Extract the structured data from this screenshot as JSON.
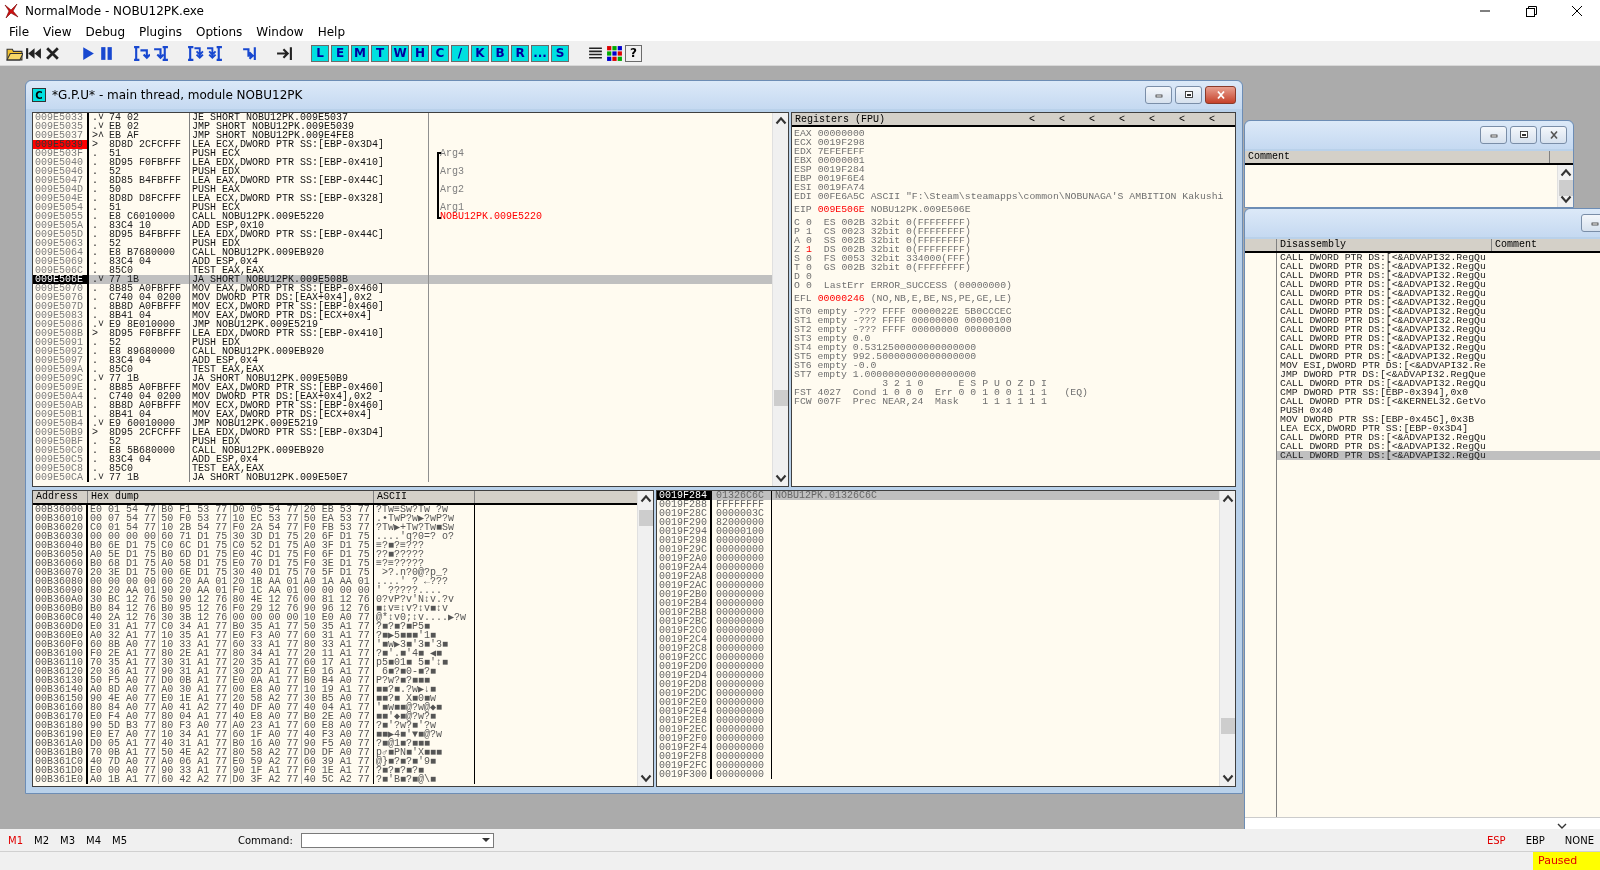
{
  "window": {
    "title": "NormalMode - NOBU12PK.exe"
  },
  "menu": [
    "File",
    "View",
    "Debug",
    "Plugins",
    "Options",
    "Window",
    "Help"
  ],
  "toolbar": {
    "letter_buttons": [
      "L",
      "E",
      "M",
      "T",
      "W",
      "H",
      "C",
      "/",
      "K",
      "B",
      "R",
      "...",
      "S"
    ],
    "help": "?"
  },
  "cpu_window": {
    "icon_letter": "C",
    "title": "*G.P.U* - main thread, module NOBU12PK"
  },
  "disassembly": {
    "rows": [
      {
        "address": "009E5033",
        "marker": ".˅",
        "hex": "74 02",
        "command": "JE SHORT NOBU12PK.009E5037",
        "selected": false,
        "breakpoint": false
      },
      {
        "address": "009E5035",
        "marker": ".˅",
        "hex": "EB 02",
        "command": "JMP SHORT NOBU12PK.009E5039",
        "selected": false,
        "breakpoint": false
      },
      {
        "address": "009E5037",
        "marker": ">˄",
        "hex": "EB AF",
        "command": "JMP SHORT NOBU12PK.009E4FE8",
        "selected": false,
        "breakpoint": false
      },
      {
        "address": "009E5039",
        "marker": ">",
        "hex": "8D8D 2CFCFFF",
        "command": "LEA ECX,DWORD PTR SS:[EBP-0x3D4]",
        "selected": false,
        "breakpoint": true
      },
      {
        "address": "009E503F",
        "marker": ".",
        "hex": "51",
        "command": "PUSH ECX",
        "comment": {
          "text": "Arg4",
          "kind": "arg"
        },
        "selected": false,
        "breakpoint": false
      },
      {
        "address": "009E5040",
        "marker": ".",
        "hex": "8D95 F0FBFFF",
        "command": "LEA EDX,DWORD PTR SS:[EBP-0x410]",
        "selected": false,
        "breakpoint": false
      },
      {
        "address": "009E5046",
        "marker": ".",
        "hex": "52",
        "command": "PUSH EDX",
        "comment": {
          "text": "Arg3",
          "kind": "arg"
        },
        "selected": false,
        "breakpoint": false
      },
      {
        "address": "009E5047",
        "marker": ".",
        "hex": "8D85 B4FBFFF",
        "command": "LEA EAX,DWORD PTR SS:[EBP-0x44C]",
        "selected": false,
        "breakpoint": false
      },
      {
        "address": "009E504D",
        "marker": ".",
        "hex": "50",
        "command": "PUSH EAX",
        "comment": {
          "text": "Arg2",
          "kind": "arg"
        },
        "selected": false,
        "breakpoint": false
      },
      {
        "address": "009E504E",
        "marker": ".",
        "hex": "8D8D D8FCFFF",
        "command": "LEA ECX,DWORD PTR SS:[EBP-0x328]",
        "selected": false,
        "breakpoint": false
      },
      {
        "address": "009E5054",
        "marker": ".",
        "hex": "51",
        "command": "PUSH ECX",
        "comment": {
          "text": "Arg1",
          "kind": "arg"
        },
        "selected": false,
        "breakpoint": false
      },
      {
        "address": "009E5055",
        "marker": ".",
        "hex": "E8 C6010000",
        "command": "CALL NOBU12PK.009E5220",
        "comment": {
          "text": "NOBU12PK.009E5220",
          "kind": "call"
        },
        "selected": false,
        "breakpoint": false
      },
      {
        "address": "009E505A",
        "marker": ".",
        "hex": "83C4 10",
        "command": "ADD ESP,0x10",
        "selected": false,
        "breakpoint": false
      },
      {
        "address": "009E505D",
        "marker": ".",
        "hex": "8D95 B4FBFFF",
        "command": "LEA EDX,DWORD PTR SS:[EBP-0x44C]",
        "selected": false,
        "breakpoint": false
      },
      {
        "address": "009E5063",
        "marker": ".",
        "hex": "52",
        "command": "PUSH EDX",
        "selected": false,
        "breakpoint": false
      },
      {
        "address": "009E5064",
        "marker": ".",
        "hex": "E8 B7680000",
        "command": "CALL NOBU12PK.009EB920",
        "selected": false,
        "breakpoint": false
      },
      {
        "address": "009E5069",
        "marker": ".",
        "hex": "83C4 04",
        "command": "ADD ESP,0x4",
        "selected": false,
        "breakpoint": false
      },
      {
        "address": "009E506C",
        "marker": ".",
        "hex": "85C0",
        "command": "TEST EAX,EAX",
        "selected": false,
        "breakpoint": false
      },
      {
        "address": "009E506E",
        "marker": ".˅",
        "hex": "77 1B",
        "command": "JA SHORT NOBU12PK.009E508B",
        "selected": true,
        "breakpoint": false
      },
      {
        "address": "009E5070",
        "marker": ".",
        "hex": "8B85 A0FBFFF",
        "command": "MOV EAX,DWORD PTR SS:[EBP-0x460]",
        "selected": false,
        "breakpoint": false
      },
      {
        "address": "009E5076",
        "marker": ".",
        "hex": "C740 04 0200",
        "command": "MOV DWORD PTR DS:[EAX+0x4],0x2",
        "selected": false,
        "breakpoint": false
      },
      {
        "address": "009E507D",
        "marker": ".",
        "hex": "8B8D A0FBFFF",
        "command": "MOV ECX,DWORD PTR SS:[EBP-0x460]",
        "selected": false,
        "breakpoint": false
      },
      {
        "address": "009E5083",
        "marker": ".",
        "hex": "8B41 04",
        "command": "MOV EAX,DWORD PTR DS:[ECX+0x4]",
        "selected": false,
        "breakpoint": false
      },
      {
        "address": "009E5086",
        "marker": ".˅",
        "hex": "E9 8E010000",
        "command": "JMP NOBU12PK.009E5219",
        "selected": false,
        "breakpoint": false
      },
      {
        "address": "009E508B",
        "marker": ">",
        "hex": "8D95 F0FBFFF",
        "command": "LEA EDX,DWORD PTR SS:[EBP-0x410]",
        "selected": false,
        "breakpoint": false
      },
      {
        "address": "009E5091",
        "marker": ".",
        "hex": "52",
        "command": "PUSH EDX",
        "selected": false,
        "breakpoint": false
      },
      {
        "address": "009E5092",
        "marker": ".",
        "hex": "E8 89680000",
        "command": "CALL NOBU12PK.009EB920",
        "selected": false,
        "breakpoint": false
      },
      {
        "address": "009E5097",
        "marker": ".",
        "hex": "83C4 04",
        "command": "ADD ESP,0x4",
        "selected": false,
        "breakpoint": false
      },
      {
        "address": "009E509A",
        "marker": ".",
        "hex": "85C0",
        "command": "TEST EAX,EAX",
        "selected": false,
        "breakpoint": false
      },
      {
        "address": "009E509C",
        "marker": ".˅",
        "hex": "77 1B",
        "command": "JA SHORT NOBU12PK.009E50B9",
        "selected": false,
        "breakpoint": false
      },
      {
        "address": "009E509E",
        "marker": ".",
        "hex": "8B85 A0FBFFF",
        "command": "MOV EAX,DWORD PTR SS:[EBP-0x460]",
        "selected": false,
        "breakpoint": false
      },
      {
        "address": "009E50A4",
        "marker": ".",
        "hex": "C740 04 0200",
        "command": "MOV DWORD PTR DS:[EAX+0x4],0x2",
        "selected": false,
        "breakpoint": false
      },
      {
        "address": "009E50AB",
        "marker": ".",
        "hex": "8B8D A0FBFFF",
        "command": "MOV ECX,DWORD PTR SS:[EBP-0x460]",
        "selected": false,
        "breakpoint": false
      },
      {
        "address": "009E50B1",
        "marker": ".",
        "hex": "8B41 04",
        "command": "MOV EAX,DWORD PTR DS:[ECX+0x4]",
        "selected": false,
        "breakpoint": false
      },
      {
        "address": "009E50B4",
        "marker": ".˅",
        "hex": "E9 60010000",
        "command": "JMP NOBU12PK.009E5219",
        "selected": false,
        "breakpoint": false
      },
      {
        "address": "009E50B9",
        "marker": ">",
        "hex": "8D95 2CFCFFF",
        "command": "LEA EDX,DWORD PTR SS:[EBP-0x3D4]",
        "selected": false,
        "breakpoint": false
      },
      {
        "address": "009E50BF",
        "marker": ".",
        "hex": "52",
        "command": "PUSH EDX",
        "selected": false,
        "breakpoint": false
      },
      {
        "address": "009E50C0",
        "marker": ".",
        "hex": "E8 5B680000",
        "command": "CALL NOBU12PK.009EB920",
        "selected": false,
        "breakpoint": false
      },
      {
        "address": "009E50C5",
        "marker": ".",
        "hex": "83C4 04",
        "command": "ADD ESP,0x4",
        "selected": false,
        "breakpoint": false
      },
      {
        "address": "009E50C8",
        "marker": ".",
        "hex": "85C0",
        "command": "TEST EAX,EAX",
        "selected": false,
        "breakpoint": false
      },
      {
        "address": "009E50CA",
        "marker": ".˅",
        "hex": "77 1B",
        "command": "JA SHORT NOBU12PK.009E50E7",
        "selected": false,
        "breakpoint": false
      }
    ]
  },
  "registers": {
    "title": "Registers (FPU)",
    "nav_arrows": [
      "<",
      "<",
      "<",
      "<",
      "<",
      "<",
      "<"
    ],
    "general": [
      {
        "name": "EAX",
        "value": "00000000",
        "changed": false
      },
      {
        "name": "ECX",
        "value": "0019F298",
        "changed": false
      },
      {
        "name": "EDX",
        "value": "7EFEFEFF",
        "changed": false
      },
      {
        "name": "EBX",
        "value": "00000001",
        "changed": false
      },
      {
        "name": "ESP",
        "value": "0019F284",
        "changed": false
      },
      {
        "name": "EBP",
        "value": "0019F6E4",
        "changed": false
      },
      {
        "name": "ESI",
        "value": "0019FA74",
        "changed": false
      },
      {
        "name": "EDI",
        "value": "00FE6A5C",
        "info": "ASCII \"F:\\Steam\\steamapps\\common\\NOBUNAGA'S AMBITION Kakushi",
        "changed": false
      }
    ],
    "eip": {
      "name": "EIP",
      "value": "009E506E",
      "info": "NOBU12PK.009E506E",
      "changed": true
    },
    "flags": [
      {
        "flag": "C",
        "value": "0",
        "changed": false,
        "segment": "ES 002B 32bit 0(FFFFFFFF)"
      },
      {
        "flag": "P",
        "value": "1",
        "changed": false,
        "segment": "CS 0023 32bit 0(FFFFFFFF)"
      },
      {
        "flag": "A",
        "value": "0",
        "changed": false,
        "segment": "SS 002B 32bit 0(FFFFFFFF)"
      },
      {
        "flag": "Z",
        "value": "1",
        "changed": true,
        "segment": "DS 002B 32bit 0(FFFFFFFF)"
      },
      {
        "flag": "S",
        "value": "0",
        "changed": false,
        "segment": "FS 0053 32bit 334000(FFF)"
      },
      {
        "flag": "T",
        "value": "0",
        "changed": false,
        "segment": "GS 002B 32bit 0(FFFFFFFF)"
      },
      {
        "flag": "D",
        "value": "0",
        "changed": false
      },
      {
        "flag": "O",
        "value": "0",
        "changed": false,
        "segment": "LastErr ERROR_SUCCESS (00000000)"
      }
    ],
    "efl": {
      "name": "EFL",
      "value": "00000246",
      "info": "(NO,NB,E,BE,NS,PE,GE,LE)",
      "changed": true
    },
    "fpu": [
      "ST0 empty -??? FFFF 0000022E 5B0CCCEC",
      "ST1 empty -??? FFFF 00000000 00000100",
      "ST2 empty -??? FFFF 00000000 00000000",
      "ST3 empty 0.0",
      "ST4 empty 0.5312500000000000000",
      "ST5 empty 992.50000000000000000",
      "ST6 empty -0.0",
      "ST7 empty 1.0000000000000000000"
    ],
    "fpu_status": [
      "               3 2 1 0      E S P U O Z D I",
      "FST 4027  Cond 1 0 0 0  Err 0 0 1 0 0 1 1 1   (EQ)",
      "FCW 007F  Prec NEAR,24  Mask    1 1 1 1 1 1"
    ]
  },
  "dump": {
    "columns": [
      "Address",
      "Hex dump",
      "ASCII"
    ],
    "rows": [
      {
        "address": "00B36000",
        "hex": "E0 01 54 77 B0 F1 53 77 D0 05 54 77 20 EB 53 77",
        "ascii": "?Tw≡Sw?Tw ?w"
      },
      {
        "address": "00B36010",
        "hex": "00 07 54 77 50 F0 53 77 10 EC 53 77 50 EA 53 77",
        "ascii": ".•TwP?w▶?wP?w"
      },
      {
        "address": "00B36020",
        "hex": "C0 01 54 77 10 2B 54 77 F0 2A 54 77 F0 FB 53 77",
        "ascii": "?Tw▶+Tw?Tw■Sw"
      },
      {
        "address": "00B36030",
        "hex": "00 00 00 00 60 71 D1 75 30 3D D1 75 20 6F D1 75",
        "ascii": "....'q?0=? o?"
      },
      {
        "address": "00B36040",
        "hex": "B0 6E D1 75 C0 6C D1 75 C0 52 D1 75 A0 3F D1 75",
        "ascii": "≡?■?≡???"
      },
      {
        "address": "00B36050",
        "hex": "A0 5E D1 75 B0 6D D1 75 E0 4C D1 75 F0 6F D1 75",
        "ascii": "??■?????"
      },
      {
        "address": "00B36060",
        "hex": "B0 68 D1 75 A0 58 D1 75 E0 70 D1 75 F0 3E D1 75",
        "ascii": "≡?≡?????"
      },
      {
        "address": "00B36070",
        "hex": "20 3E D1 75 00 6E D1 75 30 40 D1 75 70 5F D1 75",
        "ascii": " >?.n?0@?p_?"
      },
      {
        "address": "00B36080",
        "hex": "00 00 00 00 60 20 AA 01 20 1B AA 01 A0 1A AA 01",
        "ascii": "....' ? ←???"
      },
      {
        "address": "00B36090",
        "hex": "80 20 AA 01 90 20 AA 01 F0 1C AA 01 00 00 00 00",
        "ascii": "' ?????...."
      },
      {
        "address": "00B360A0",
        "hex": "30 BC 12 76 50 90 12 76 80 4E 12 76 00 81 12 76",
        "ascii": "0?vP?v'N↕v.?v"
      },
      {
        "address": "00B360B0",
        "hex": "B0 84 12 76 B0 95 12 76 F0 29 12 76 90 96 12 76",
        "ascii": "■↕v≡↕v?↕v■↕v"
      },
      {
        "address": "00B360C0",
        "hex": "40 2A 12 76 30 3B 12 76 00 00 00 00 10 E0 A0 77",
        "ascii": "@*↕v0;↕v....▶?w"
      },
      {
        "address": "00B360D0",
        "hex": "E0 31 A1 77 C0 34 A1 77 B0 35 A1 77 50 35 A1 77",
        "ascii": "?■?■?■P5■"
      },
      {
        "address": "00B360E0",
        "hex": "A0 32 A1 77 10 35 A1 77 E0 F3 A0 77 60 31 A1 77",
        "ascii": "?■▶5■■■'1■"
      },
      {
        "address": "00B360F0",
        "hex": "60 8B A0 77 10 33 A1 77 60 33 A1 77 80 33 A1 77",
        "ascii": "'■w▶3■'3■'3■"
      },
      {
        "address": "00B36100",
        "hex": "F0 2E A1 77 80 2E A1 77 80 34 A1 77 20 11 A1 77",
        "ascii": "?■'.■'4■ ◀■"
      },
      {
        "address": "00B36110",
        "hex": "70 35 A1 77 30 31 A1 77 20 35 A1 77 60 17 A1 77",
        "ascii": "p5■01■ 5■'↕■"
      },
      {
        "address": "00B36120",
        "hex": "20 36 A1 77 90 31 A1 77 30 2D A1 77 E0 16 A1 77",
        "ascii": " 6■?■0-■?■"
      },
      {
        "address": "00B36130",
        "hex": "50 F5 A0 77 D0 0B A1 77 E0 0A A1 77 B0 B4 A0 77",
        "ascii": "P?w?■?■■■"
      },
      {
        "address": "00B36140",
        "hex": "A0 8D A0 77 A0 30 A1 77 00 E8 A0 77 10 19 A1 77",
        "ascii": "■■?■.?w▶↓■"
      },
      {
        "address": "00B36150",
        "hex": "90 4E A0 77 E0 1E A1 77 20 58 A2 77 30 B5 A0 77",
        "ascii": "■■?■ X■0■w"
      },
      {
        "address": "00B36160",
        "hex": "80 84 A0 77 A0 41 A2 77 40 DF A0 77 40 04 A1 77",
        "ascii": "'■w■■@?w@◆■"
      },
      {
        "address": "00B36170",
        "hex": "E0 F4 A0 77 80 04 A1 77 40 E8 A0 77 B0 2E A0 77",
        "ascii": "■■'◆■@?w?■"
      },
      {
        "address": "00B36180",
        "hex": "90 5D B3 77 80 F3 A0 77 A0 23 A1 77 60 E8 A0 77",
        "ascii": "?■'?w?■'?w"
      },
      {
        "address": "00B36190",
        "hex": "E0 E7 A0 77 10 34 A1 77 60 1F A0 77 40 F3 A0 77",
        "ascii": "■■▶4■'▼■@?w"
      },
      {
        "address": "00B361A0",
        "hex": "D0 05 A1 77 40 31 A1 77 B0 16 A0 77 90 F5 A0 77",
        "ascii": "?■@1■?■■■"
      },
      {
        "address": "00B361B0",
        "hex": "70 0B A1 77 50 4E A2 77 80 58 A2 77 D0 DF A0 77",
        "ascii": "p♂■PN■'X■■■"
      },
      {
        "address": "00B361C0",
        "hex": "40 7D A0 77 A0 06 A1 77 E0 59 A2 77 60 39 A1 77",
        "ascii": "@}■?■?■'9■"
      },
      {
        "address": "00B361D0",
        "hex": "E0 00 A0 77 90 33 A1 77 90 1F A1 77 F0 1E A1 77",
        "ascii": "?■?■?■?■"
      },
      {
        "address": "00B361E0",
        "hex": "A0 1B A1 77 60 42 A2 77 D0 3F A2 77 40 5C A2 77",
        "ascii": "?■'B■?■@\\■"
      }
    ]
  },
  "stack": {
    "rows": [
      {
        "address": "0019F284",
        "value": "01326C6C",
        "comment": "NOBU12PK.01326C6C",
        "selected": true
      },
      {
        "address": "0019F288",
        "value": "FFFFFFFF",
        "selected": false
      },
      {
        "address": "0019F28C",
        "value": "0000003C",
        "selected": false
      },
      {
        "address": "0019F290",
        "value": "82000000",
        "selected": false
      },
      {
        "address": "0019F294",
        "value": "00000100",
        "selected": false
      },
      {
        "address": "0019F298",
        "value": "00000000",
        "selected": false
      },
      {
        "address": "0019F29C",
        "value": "00000000",
        "selected": false
      },
      {
        "address": "0019F2A0",
        "value": "00000000",
        "selected": false
      },
      {
        "address": "0019F2A4",
        "value": "00000000",
        "selected": false
      },
      {
        "address": "0019F2A8",
        "value": "00000000",
        "selected": false
      },
      {
        "address": "0019F2AC",
        "value": "00000000",
        "selected": false
      },
      {
        "address": "0019F2B0",
        "value": "00000000",
        "selected": false
      },
      {
        "address": "0019F2B4",
        "value": "00000000",
        "selected": false
      },
      {
        "address": "0019F2B8",
        "value": "00000000",
        "selected": false
      },
      {
        "address": "0019F2BC",
        "value": "00000000",
        "selected": false
      },
      {
        "address": "0019F2C0",
        "value": "00000000",
        "selected": false
      },
      {
        "address": "0019F2C4",
        "value": "00000000",
        "selected": false
      },
      {
        "address": "0019F2C8",
        "value": "00000000",
        "selected": false
      },
      {
        "address": "0019F2CC",
        "value": "00000000",
        "selected": false
      },
      {
        "address": "0019F2D0",
        "value": "00000000",
        "selected": false
      },
      {
        "address": "0019F2D4",
        "value": "00000000",
        "selected": false
      },
      {
        "address": "0019F2D8",
        "value": "00000000",
        "selected": false
      },
      {
        "address": "0019F2DC",
        "value": "00000000",
        "selected": false
      },
      {
        "address": "0019F2E0",
        "value": "00000000",
        "selected": false
      },
      {
        "address": "0019F2E4",
        "value": "00000000",
        "selected": false
      },
      {
        "address": "0019F2E8",
        "value": "00000000",
        "selected": false
      },
      {
        "address": "0019F2EC",
        "value": "00000000",
        "selected": false
      },
      {
        "address": "0019F2F0",
        "value": "00000000",
        "selected": false
      },
      {
        "address": "0019F2F4",
        "value": "00000000",
        "selected": false
      },
      {
        "address": "0019F2F8",
        "value": "00000000",
        "selected": false
      },
      {
        "address": "0019F2FC",
        "value": "00000000",
        "selected": false
      },
      {
        "address": "0019F300",
        "value": "00000000",
        "selected": false
      }
    ]
  },
  "background_windows": [
    {
      "columns": [
        "Comment"
      ]
    },
    {
      "columns": [
        "Disassembly",
        "Comment"
      ],
      "rows": [
        {
          "text": "CALL DWORD PTR DS:[<&ADVAPI32.RegQu",
          "selected": false
        },
        {
          "text": "CALL DWORD PTR DS:[<&ADVAPI32.RegQu",
          "selected": false
        },
        {
          "text": "CALL DWORD PTR DS:[<&ADVAPI32.RegQu",
          "selected": false
        },
        {
          "text": "CALL DWORD PTR DS:[<&ADVAPI32.RegQu",
          "selected": false
        },
        {
          "text": "CALL DWORD PTR DS:[<&ADVAPI32.RegQu",
          "selected": false
        },
        {
          "text": "CALL DWORD PTR DS:[<&ADVAPI32.RegQu",
          "selected": false
        },
        {
          "text": "CALL DWORD PTR DS:[<&ADVAPI32.RegQu",
          "selected": false
        },
        {
          "text": "CALL DWORD PTR DS:[<&ADVAPI32.RegQu",
          "selected": false
        },
        {
          "text": "CALL DWORD PTR DS:[<&ADVAPI32.RegQu",
          "selected": false
        },
        {
          "text": "CALL DWORD PTR DS:[<&ADVAPI32.RegQu",
          "selected": false
        },
        {
          "text": "CALL DWORD PTR DS:[<&ADVAPI32.RegQu",
          "selected": false
        },
        {
          "text": "CALL DWORD PTR DS:[<&ADVAPI32.RegQu",
          "selected": false
        },
        {
          "text": "MOV ESI,DWORD PTR DS:[<&ADVAPI32.Re",
          "selected": false
        },
        {
          "text": "JMP DWORD PTR DS:[<&ADVAPI32.RegQue",
          "selected": false
        },
        {
          "text": "CALL DWORD PTR DS:[<&ADVAPI32.RegQu",
          "selected": false
        },
        {
          "text": "CMP DWORD PTR SS:[EBP-0x394],0x0",
          "selected": false
        },
        {
          "text": "CALL DWORD PTR DS:[<&KERNEL32.GetVo",
          "selected": false
        },
        {
          "text": "PUSH 0x40",
          "selected": false
        },
        {
          "text": "MOV DWORD PTR SS:[EBP-0x45C],0x3B",
          "selected": false
        },
        {
          "text": "LEA ECX,DWORD PTR SS:[EBP-0x3D4]",
          "selected": false
        },
        {
          "text": "CALL DWORD PTR DS:[<&ADVAPI32.RegQu",
          "selected": false
        },
        {
          "text": "CALL DWORD PTR DS:[<&ADVAPI32.RegQu",
          "selected": false
        },
        {
          "text": "CALL DWORD PTR DS:[<&ADVAPI32.RegQu",
          "selected": true
        }
      ]
    }
  ],
  "command_bar": {
    "memory_tabs": [
      {
        "label": "M1",
        "selected": true
      },
      {
        "label": "M2",
        "selected": false
      },
      {
        "label": "M3",
        "selected": false
      },
      {
        "label": "M4",
        "selected": false
      },
      {
        "label": "M5",
        "selected": false
      }
    ],
    "command_label": "Command:",
    "register_modes": [
      {
        "label": "ESP",
        "selected": true
      },
      {
        "label": "EBP",
        "selected": false
      },
      {
        "label": "NONE",
        "selected": false
      }
    ]
  },
  "status_bar": {
    "state": "Paused"
  }
}
